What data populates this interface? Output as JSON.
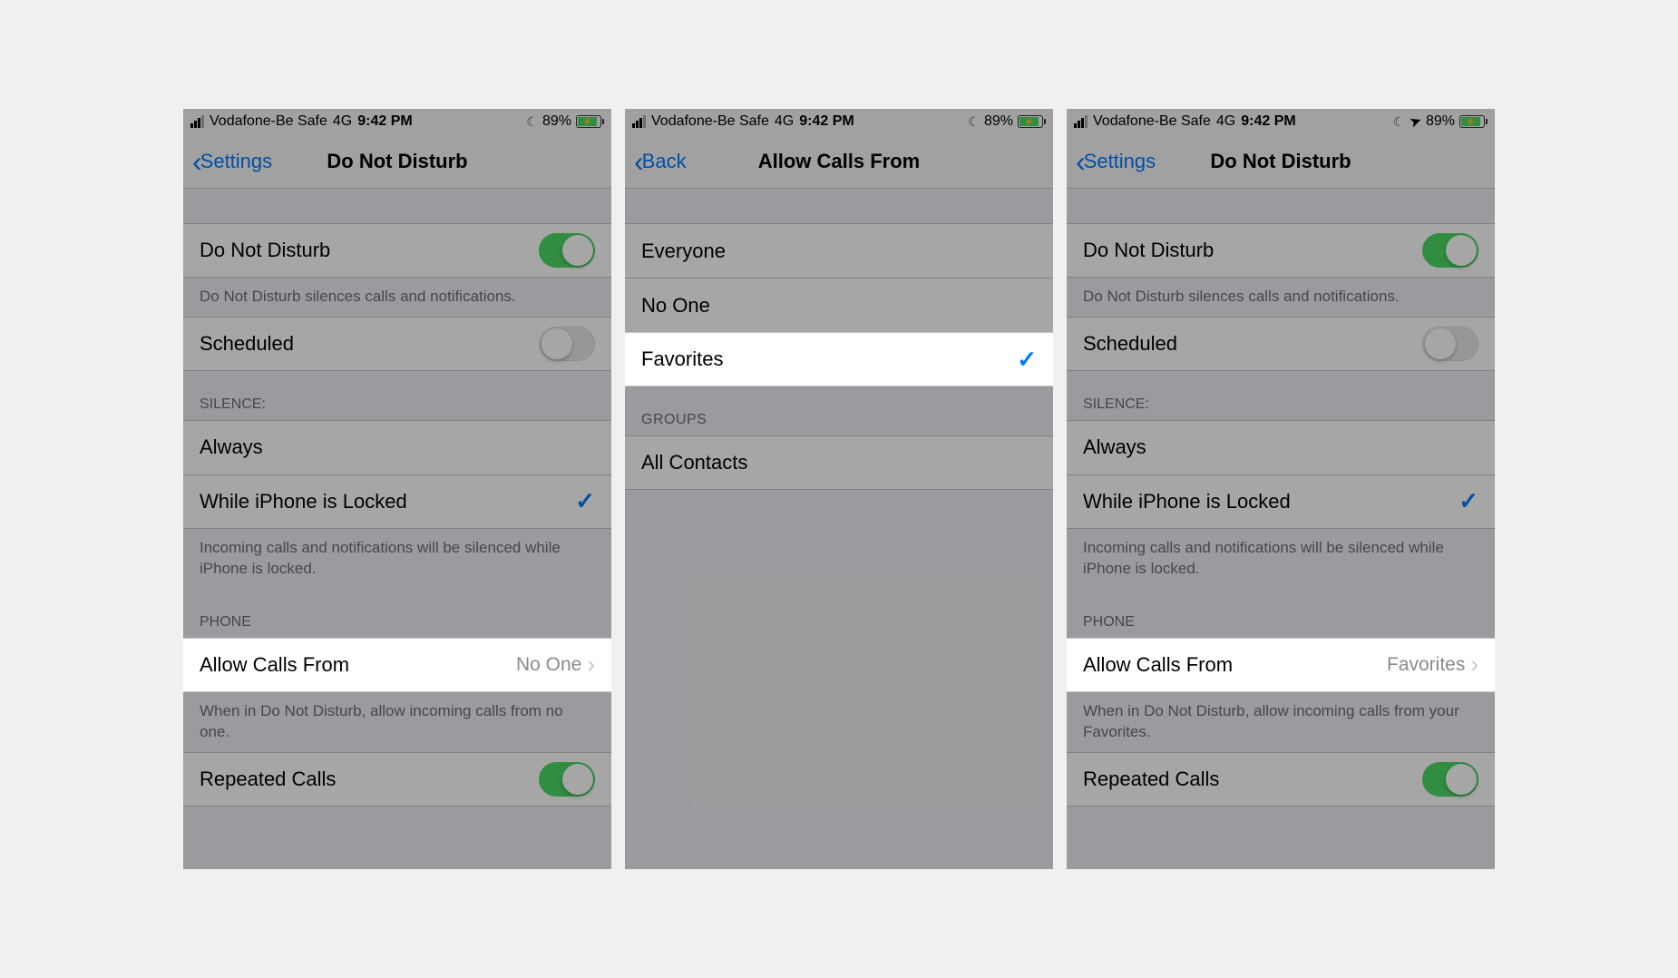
{
  "status": {
    "carrier": "Vodafone-Be Safe",
    "network": "4G",
    "time": "9:42 PM",
    "battery_pct": "89%"
  },
  "screens": [
    {
      "back_label": "Settings",
      "title": "Do Not Disturb",
      "rows": {
        "dnd_label": "Do Not Disturb",
        "dnd_footer": "Do Not Disturb silences calls and notifications.",
        "scheduled_label": "Scheduled",
        "silence_header": "SILENCE:",
        "always_label": "Always",
        "while_locked_label": "While iPhone is Locked",
        "silence_footer": "Incoming calls and notifications will be silenced while iPhone is locked.",
        "phone_header": "PHONE",
        "allow_calls_label": "Allow Calls From",
        "allow_calls_value": "No One",
        "allow_calls_footer": "When in Do Not Disturb, allow incoming calls from no one.",
        "repeated_label": "Repeated Calls"
      }
    },
    {
      "back_label": "Back",
      "title": "Allow Calls From",
      "options": {
        "everyone": "Everyone",
        "no_one": "No One",
        "favorites": "Favorites",
        "groups_header": "GROUPS",
        "all_contacts": "All Contacts"
      }
    },
    {
      "back_label": "Settings",
      "title": "Do Not Disturb",
      "rows": {
        "dnd_label": "Do Not Disturb",
        "dnd_footer": "Do Not Disturb silences calls and notifications.",
        "scheduled_label": "Scheduled",
        "silence_header": "SILENCE:",
        "always_label": "Always",
        "while_locked_label": "While iPhone is Locked",
        "silence_footer": "Incoming calls and notifications will be silenced while iPhone is locked.",
        "phone_header": "PHONE",
        "allow_calls_label": "Allow Calls From",
        "allow_calls_value": "Favorites",
        "allow_calls_footer": "When in Do Not Disturb, allow incoming calls from your Favorites.",
        "repeated_label": "Repeated Calls"
      }
    }
  ]
}
